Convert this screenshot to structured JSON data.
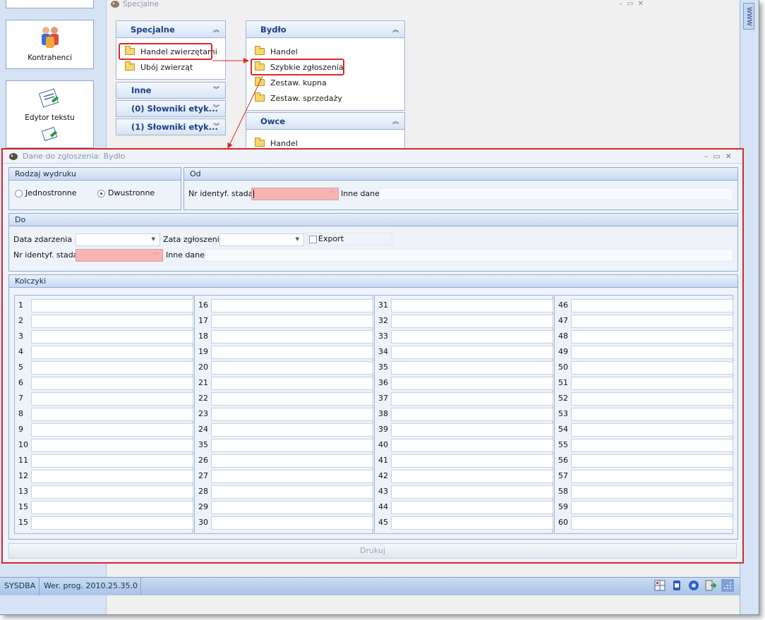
{
  "launcher": {
    "kontrahenci_label": "Kontrahenci",
    "edytor_label": "Edytor tekstu"
  },
  "side_tab_label": "WWW",
  "background_window": {
    "title": "Specjalne",
    "groups": {
      "specjalne": {
        "title": "Specjalne",
        "items": [
          "Handel zwierzętami",
          "Ubój zwierząt"
        ]
      },
      "inne": {
        "title": "Inne"
      },
      "slowniki0": {
        "title": "(0) Słowniki etyk..."
      },
      "slowniki1": {
        "title": "(1) Słowniki etyk..."
      },
      "bydlo": {
        "title": "Bydło",
        "items": [
          "Handel",
          "Szybkie zgłoszenia",
          "Zestaw. kupna",
          "Zestaw. sprzedaży"
        ]
      },
      "owce": {
        "title": "Owce",
        "items": [
          "Handel"
        ]
      }
    }
  },
  "dialog": {
    "title": "Dane do zgłoszenia: Bydło",
    "rodzaj": {
      "title": "Rodzaj wydruku",
      "option1": "Jednostronne",
      "option2": "Dwustronne",
      "selected": "Dwustronne"
    },
    "od": {
      "title": "Od",
      "nr_label": "Nr identyf. stada",
      "inne_label": "Inne dane"
    },
    "do": {
      "title": "Do",
      "data_label": "Data zdarzenia",
      "zata_label": "Zata zgłoszenia",
      "export_label": "Export",
      "nr_label": "Nr identyf. stada",
      "inne_label": "Inne dane"
    },
    "kolczyki": {
      "title": "Kolczyki",
      "columns": [
        [
          "1",
          "2",
          "3",
          "4",
          "5",
          "6",
          "7",
          "8",
          "9",
          "10",
          "11",
          "12",
          "13",
          "15",
          "15"
        ],
        [
          "16",
          "17",
          "18",
          "19",
          "20",
          "21",
          "22",
          "23",
          "24",
          "35",
          "26",
          "27",
          "28",
          "29",
          "30"
        ],
        [
          "31",
          "32",
          "33",
          "34",
          "35",
          "36",
          "37",
          "38",
          "39",
          "40",
          "41",
          "42",
          "43",
          "44",
          "45"
        ],
        [
          "46",
          "47",
          "48",
          "49",
          "50",
          "51",
          "52",
          "53",
          "54",
          "55",
          "56",
          "57",
          "58",
          "59",
          "60"
        ]
      ]
    },
    "print_label": "Drukuj"
  },
  "status": {
    "user": "SYSDBA",
    "version": "Wer. prog. 2010.25.35.0"
  },
  "colors": {
    "highlight": "#e0262a",
    "required_field": "#f8b4b4",
    "group_title": "#1c3f83"
  }
}
